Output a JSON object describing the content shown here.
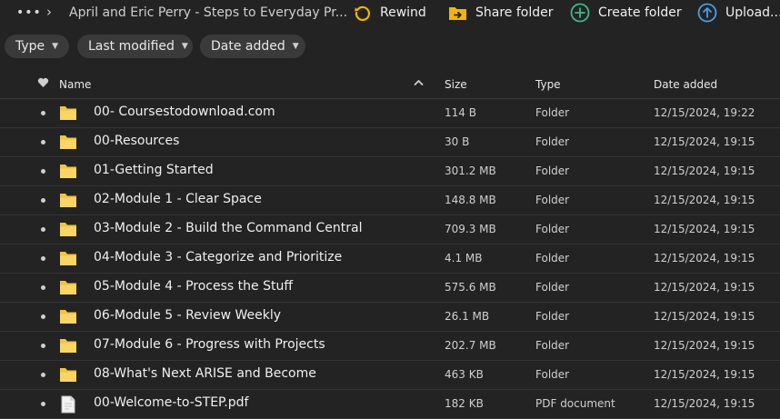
{
  "topbar": {
    "more_glyph": "•••",
    "breadcrumb_sep": "›",
    "breadcrumb": "April and Eric Perry - Steps to Everyday Pr...",
    "actions": [
      {
        "label": "Rewind",
        "icon": "rewind-icon",
        "color": "#f5b400"
      },
      {
        "label": "Share folder",
        "icon": "share-folder-icon",
        "color": "#f5b400"
      },
      {
        "label": "Create folder",
        "icon": "create-folder-icon",
        "color": "#3fb98a"
      },
      {
        "label": "Upload...",
        "icon": "upload-icon",
        "color": "#4a9fe0"
      }
    ]
  },
  "filters": [
    {
      "label": "Type"
    },
    {
      "label": "Last modified"
    },
    {
      "label": "Date added"
    }
  ],
  "columns": {
    "favorite_icon": "heart-icon",
    "name": "Name",
    "sort_icon": "chevron-up-icon",
    "size": "Size",
    "type": "Type",
    "date_added": "Date added"
  },
  "files": [
    {
      "name": "00- Coursestodownload.com",
      "size": "114 B",
      "type": "Folder",
      "date": "12/15/2024, 19:22",
      "icon": "folder-icon"
    },
    {
      "name": "00-Resources",
      "size": "30 B",
      "type": "Folder",
      "date": "12/15/2024, 19:15",
      "icon": "folder-icon"
    },
    {
      "name": "01-Getting Started",
      "size": "301.2 MB",
      "type": "Folder",
      "date": "12/15/2024, 19:15",
      "icon": "folder-icon"
    },
    {
      "name": "02-Module 1 - Clear Space",
      "size": "148.8 MB",
      "type": "Folder",
      "date": "12/15/2024, 19:15",
      "icon": "folder-icon"
    },
    {
      "name": "03-Module 2 - Build the Command Central",
      "size": "709.3 MB",
      "type": "Folder",
      "date": "12/15/2024, 19:15",
      "icon": "folder-icon"
    },
    {
      "name": "04-Module 3 - Categorize and Prioritize",
      "size": "4.1 MB",
      "type": "Folder",
      "date": "12/15/2024, 19:15",
      "icon": "folder-icon"
    },
    {
      "name": "05-Module 4 - Process the Stuff",
      "size": "575.6 MB",
      "type": "Folder",
      "date": "12/15/2024, 19:15",
      "icon": "folder-icon"
    },
    {
      "name": "06-Module 5 - Review Weekly",
      "size": "26.1 MB",
      "type": "Folder",
      "date": "12/15/2024, 19:15",
      "icon": "folder-icon"
    },
    {
      "name": "07-Module 6 - Progress with Projects",
      "size": "202.7 MB",
      "type": "Folder",
      "date": "12/15/2024, 19:15",
      "icon": "folder-icon"
    },
    {
      "name": "08-What's Next ARISE and Become",
      "size": "463 KB",
      "type": "Folder",
      "date": "12/15/2024, 19:15",
      "icon": "folder-icon"
    },
    {
      "name": "00-Welcome-to-STEP.pdf",
      "size": "182 KB",
      "type": "PDF document",
      "date": "12/15/2024, 19:15",
      "icon": "pdf-file-icon"
    }
  ]
}
